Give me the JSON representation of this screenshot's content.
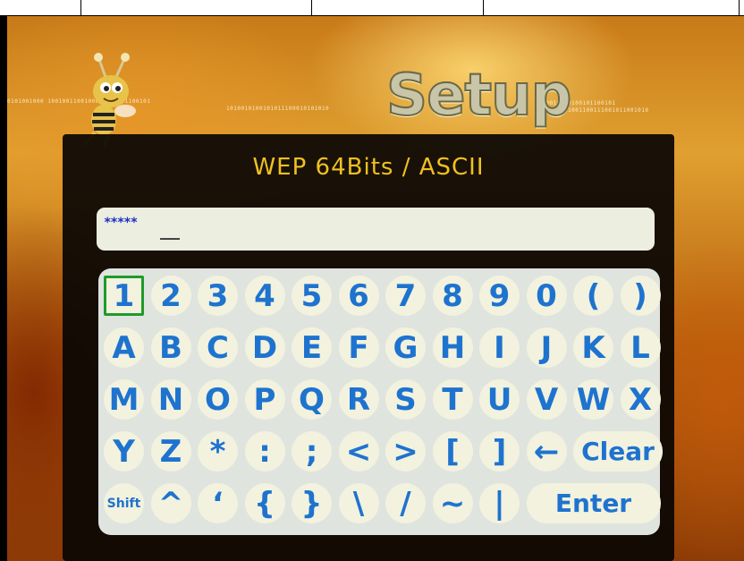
{
  "screen": {
    "title": "Setup",
    "binary_left": "0101001000 1001001100100000100101100101",
    "binary_left2": "1010010100101011100010101010",
    "binary_right": "0110010000100101100101",
    "binary_right2": "1010101001001100111001011001010"
  },
  "dialog": {
    "title": "WEP 64Bits / ASCII",
    "input_value": "*****"
  },
  "keyboard": {
    "rows": [
      [
        "1",
        "2",
        "3",
        "4",
        "5",
        "6",
        "7",
        "8",
        "9",
        "0",
        "(",
        ")"
      ],
      [
        "A",
        "B",
        "C",
        "D",
        "E",
        "F",
        "G",
        "H",
        "I",
        "J",
        "K",
        "L"
      ],
      [
        "M",
        "N",
        "O",
        "P",
        "Q",
        "R",
        "S",
        "T",
        "U",
        "V",
        "W",
        "X"
      ],
      [
        "Y",
        "Z",
        "*",
        ":",
        ";",
        "<",
        ">",
        "[",
        "]",
        "←",
        "Clear"
      ],
      [
        "Shift",
        "^",
        "‘",
        "{",
        "}",
        "\\",
        "/",
        "~",
        "|",
        "Enter"
      ]
    ],
    "selected_key": "1"
  },
  "colors": {
    "key_text": "#1e73cf",
    "key_face": "#f2f2de",
    "selection": "#1f9a2a",
    "title_text": "#f0c020"
  }
}
